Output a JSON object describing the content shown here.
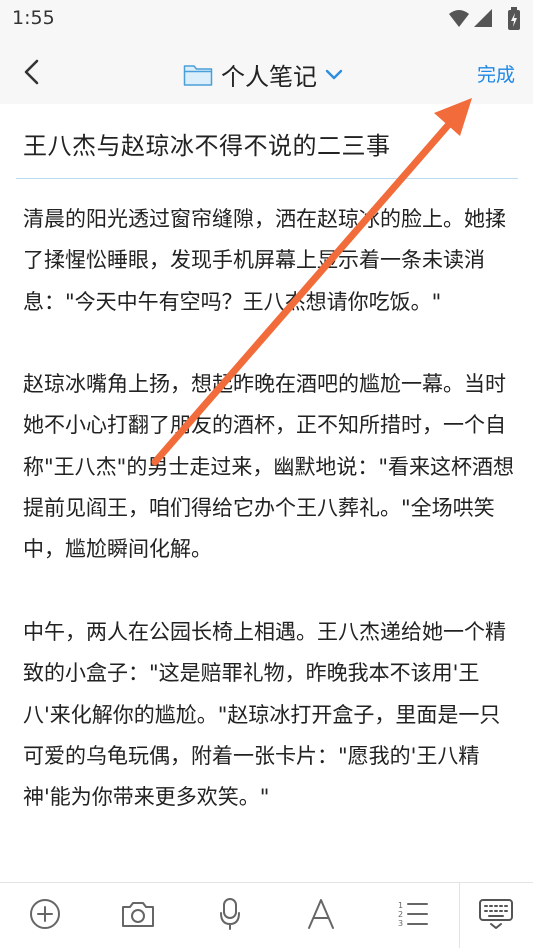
{
  "status": {
    "time": "1:55"
  },
  "header": {
    "folder_name": "个人笔记",
    "done_label": "完成"
  },
  "note": {
    "title": "王八杰与赵琼冰不得不说的二三事",
    "body": "清晨的阳光透过窗帘缝隙，洒在赵琼冰的脸上。她揉了揉惺忪睡眼，发现手机屏幕上显示着一条未读消息：\"今天中午有空吗？王八杰想请你吃饭。\"\n\n赵琼冰嘴角上扬，想起昨晚在酒吧的尴尬一幕。当时她不小心打翻了朋友的酒杯，正不知所措时，一个自称\"王八杰\"的男士走过来，幽默地说：\"看来这杯酒想提前见阎王，咱们得给它办个王八葬礼。\"全场哄笑中，尴尬瞬间化解。\n\n中午，两人在公园长椅上相遇。王八杰递给她一个精致的小盒子：\"这是赔罪礼物，昨晚我本不该用'王八'来化解你的尴尬。\"赵琼冰打开盒子，里面是一只可爱的乌龟玩偶，附着一张卡片：\"愿我的'王八精神'能为你带来更多欢笑。\""
  },
  "toolbar": {
    "items": [
      "add-icon",
      "camera-icon",
      "microphone-icon",
      "text-format-icon",
      "numbered-list-icon",
      "keyboard-icon"
    ]
  },
  "annotation": {
    "color": "#f26b3a"
  }
}
